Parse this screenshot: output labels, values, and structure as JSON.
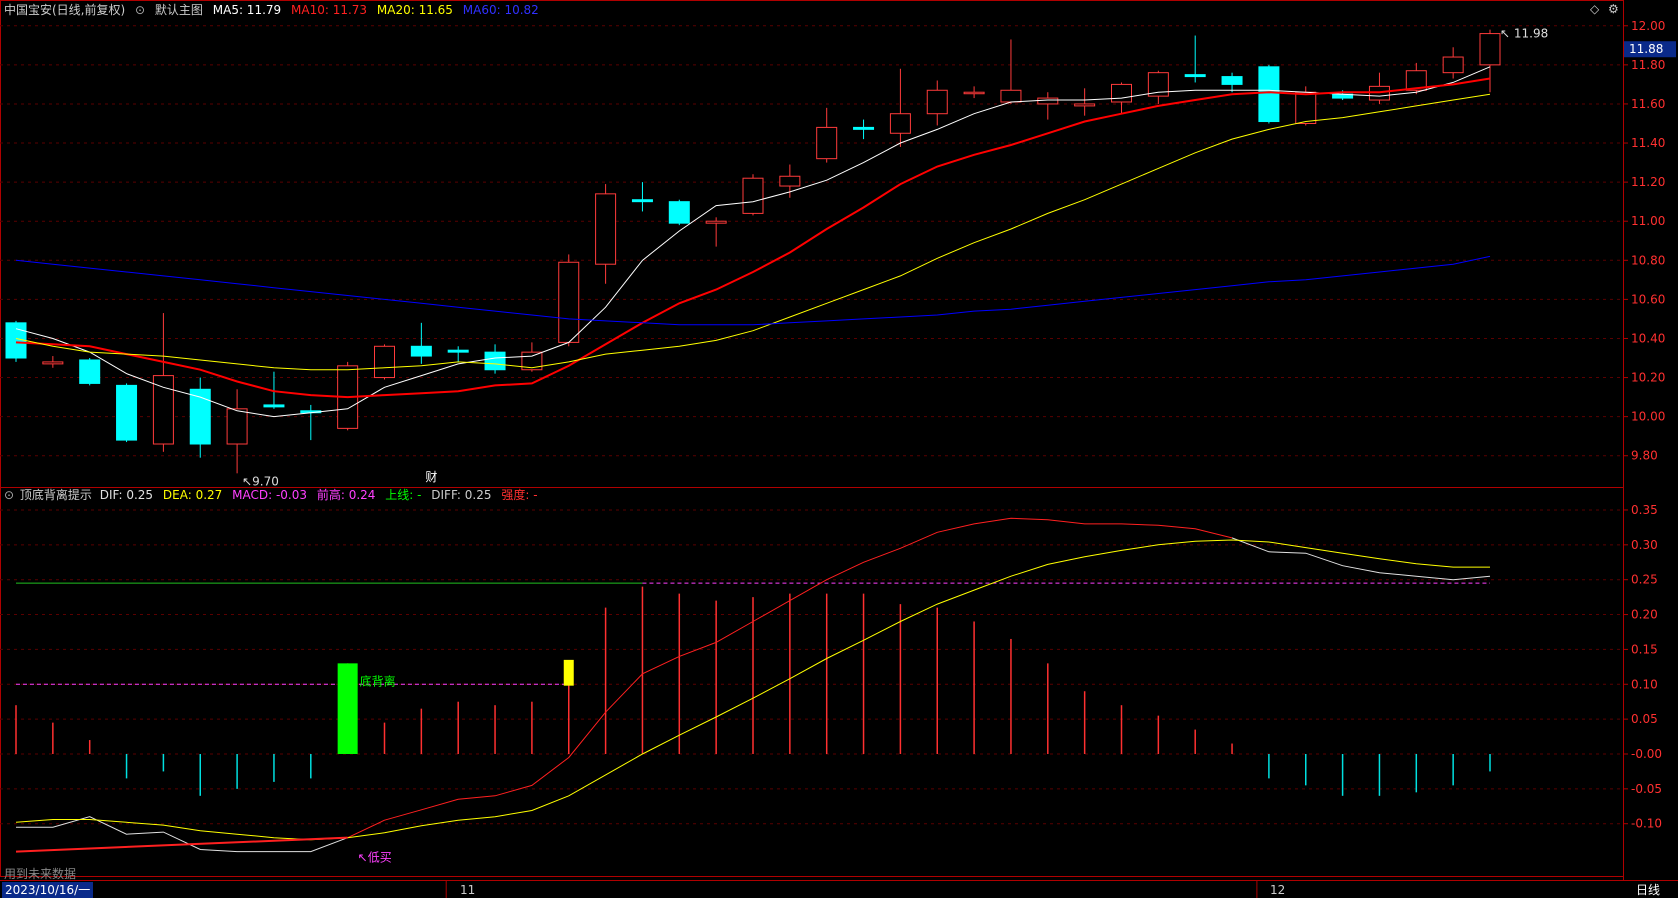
{
  "main_header": {
    "stock": "中国宝安(日线,前复权)",
    "template": "默认主图",
    "ma5": "MA5: 11.79",
    "ma10": "MA10: 11.73",
    "ma20": "MA20: 11.65",
    "ma60": "MA60: 10.82"
  },
  "sub_header": {
    "name": "顶底背离提示",
    "dif": "DIF: 0.25",
    "dea": "DEA: 0.27",
    "macd": "MACD: -0.03",
    "prev_high": "前高: 0.24",
    "upper_line": "上线: -",
    "diff": "DIFF: 0.25",
    "strength": "强度: -"
  },
  "colors": {
    "up": "#ff3b3b",
    "down": "#00ffff",
    "ma5": "#ffffff",
    "ma10": "#ff0000",
    "ma20": "#ffff00",
    "ma60": "#0000ff",
    "axis": "#b00000",
    "grid": "#5a0000",
    "dif": "#e0e0e0",
    "dea": "#ffff00"
  },
  "chart_data": [
    {
      "type": "candlestick",
      "title": "中国宝安(日线,前复权)",
      "ylim": [
        9.64,
        12.05
      ],
      "ticks": [
        "12.00",
        "11.80",
        "11.60",
        "11.40",
        "11.20",
        "11.00",
        "10.80",
        "10.60",
        "10.40",
        "10.20",
        "10.00",
        "9.80"
      ],
      "current_price": "11.88",
      "high_label": "11.98",
      "low_label": "9.70",
      "event_label": "财",
      "candles": [
        {
          "o": 10.48,
          "c": 10.3,
          "h": 10.49,
          "l": 10.28
        },
        {
          "o": 10.27,
          "c": 10.28,
          "h": 10.31,
          "l": 10.25
        },
        {
          "o": 10.29,
          "c": 10.17,
          "h": 10.3,
          "l": 10.16
        },
        {
          "o": 10.16,
          "c": 9.88,
          "h": 10.17,
          "l": 9.87
        },
        {
          "o": 9.86,
          "c": 10.21,
          "h": 10.53,
          "l": 9.82
        },
        {
          "o": 10.14,
          "c": 9.86,
          "h": 10.2,
          "l": 9.79
        },
        {
          "o": 9.86,
          "c": 10.04,
          "h": 10.14,
          "l": 9.71
        },
        {
          "o": 10.06,
          "c": 10.05,
          "h": 10.23,
          "l": 10.04
        },
        {
          "o": 10.03,
          "c": 10.02,
          "h": 10.06,
          "l": 9.88
        },
        {
          "o": 9.94,
          "c": 10.26,
          "h": 10.28,
          "l": 9.93
        },
        {
          "o": 10.2,
          "c": 10.36,
          "h": 10.37,
          "l": 10.19
        },
        {
          "o": 10.36,
          "c": 10.31,
          "h": 10.48,
          "l": 10.27
        },
        {
          "o": 10.34,
          "c": 10.33,
          "h": 10.36,
          "l": 10.28
        },
        {
          "o": 10.33,
          "c": 10.24,
          "h": 10.37,
          "l": 10.22
        },
        {
          "o": 10.24,
          "c": 10.33,
          "h": 10.38,
          "l": 10.23
        },
        {
          "o": 10.38,
          "c": 10.79,
          "h": 10.83,
          "l": 10.36
        },
        {
          "o": 10.78,
          "c": 11.14,
          "h": 11.19,
          "l": 10.68
        },
        {
          "o": 11.11,
          "c": 11.1,
          "h": 11.2,
          "l": 11.05
        },
        {
          "o": 11.1,
          "c": 10.99,
          "h": 11.11,
          "l": 10.98
        },
        {
          "o": 10.99,
          "c": 11.0,
          "h": 11.02,
          "l": 10.87
        },
        {
          "o": 11.04,
          "c": 11.22,
          "h": 11.24,
          "l": 11.03
        },
        {
          "o": 11.18,
          "c": 11.23,
          "h": 11.29,
          "l": 11.12
        },
        {
          "o": 11.32,
          "c": 11.48,
          "h": 11.58,
          "l": 11.3
        },
        {
          "o": 11.48,
          "c": 11.47,
          "h": 11.52,
          "l": 11.42
        },
        {
          "o": 11.45,
          "c": 11.55,
          "h": 11.78,
          "l": 11.38
        },
        {
          "o": 11.55,
          "c": 11.67,
          "h": 11.72,
          "l": 11.49
        },
        {
          "o": 11.66,
          "c": 11.66,
          "h": 11.69,
          "l": 11.63
        },
        {
          "o": 11.61,
          "c": 11.67,
          "h": 11.93,
          "l": 11.6
        },
        {
          "o": 11.6,
          "c": 11.63,
          "h": 11.66,
          "l": 11.52
        },
        {
          "o": 11.59,
          "c": 11.6,
          "h": 11.68,
          "l": 11.54
        },
        {
          "o": 11.61,
          "c": 11.7,
          "h": 11.71,
          "l": 11.55
        },
        {
          "o": 11.64,
          "c": 11.76,
          "h": 11.77,
          "l": 11.6
        },
        {
          "o": 11.75,
          "c": 11.74,
          "h": 11.95,
          "l": 11.71
        },
        {
          "o": 11.74,
          "c": 11.7,
          "h": 11.76,
          "l": 11.66
        },
        {
          "o": 11.79,
          "c": 11.51,
          "h": 11.8,
          "l": 11.5
        },
        {
          "o": 11.5,
          "c": 11.66,
          "h": 11.69,
          "l": 11.49
        },
        {
          "o": 11.65,
          "c": 11.63,
          "h": 11.67,
          "l": 11.62
        },
        {
          "o": 11.62,
          "c": 11.69,
          "h": 11.76,
          "l": 11.6
        },
        {
          "o": 11.67,
          "c": 11.77,
          "h": 11.81,
          "l": 11.65
        },
        {
          "o": 11.76,
          "c": 11.84,
          "h": 11.89,
          "l": 11.73
        },
        {
          "o": 11.8,
          "c": 11.96,
          "h": 11.98,
          "l": 11.66
        }
      ],
      "series": [
        {
          "name": "MA5",
          "color": "#ffffff",
          "values": [
            10.45,
            10.4,
            10.33,
            10.22,
            10.15,
            10.1,
            10.03,
            10.0,
            10.02,
            10.04,
            10.15,
            10.21,
            10.27,
            10.3,
            10.31,
            10.38,
            10.56,
            10.8,
            10.95,
            11.08,
            11.1,
            11.15,
            11.21,
            11.3,
            11.4,
            11.47,
            11.55,
            11.61,
            11.62,
            11.62,
            11.63,
            11.66,
            11.67,
            11.67,
            11.67,
            11.66,
            11.65,
            11.64,
            11.66,
            11.71,
            11.79
          ]
        },
        {
          "name": "MA10",
          "color": "#ff0000",
          "values": [
            10.38,
            10.37,
            10.36,
            10.32,
            10.28,
            10.24,
            10.18,
            10.13,
            10.11,
            10.1,
            10.11,
            10.12,
            10.13,
            10.16,
            10.17,
            10.26,
            10.37,
            10.48,
            10.58,
            10.65,
            10.74,
            10.84,
            10.96,
            11.07,
            11.19,
            11.28,
            11.34,
            11.39,
            11.45,
            11.51,
            11.55,
            11.59,
            11.62,
            11.65,
            11.66,
            11.65,
            11.66,
            11.66,
            11.68,
            11.7,
            11.73
          ]
        },
        {
          "name": "MA20",
          "color": "#ffff00",
          "values": [
            10.4,
            10.36,
            10.33,
            10.32,
            10.31,
            10.29,
            10.27,
            10.25,
            10.24,
            10.24,
            10.25,
            10.26,
            10.28,
            10.27,
            10.25,
            10.28,
            10.32,
            10.34,
            10.36,
            10.39,
            10.44,
            10.51,
            10.58,
            10.65,
            10.72,
            10.81,
            10.89,
            10.96,
            11.04,
            11.11,
            11.19,
            11.27,
            11.35,
            11.42,
            11.47,
            11.51,
            11.53,
            11.56,
            11.59,
            11.62,
            11.65
          ]
        },
        {
          "name": "MA60",
          "color": "#0000ff",
          "values": [
            10.8,
            10.78,
            10.76,
            10.74,
            10.72,
            10.7,
            10.68,
            10.66,
            10.64,
            10.62,
            10.6,
            10.58,
            10.56,
            10.54,
            10.52,
            10.5,
            10.49,
            10.48,
            10.47,
            10.47,
            10.47,
            10.48,
            10.49,
            10.5,
            10.51,
            10.52,
            10.54,
            10.55,
            10.57,
            10.59,
            10.61,
            10.63,
            10.65,
            10.67,
            10.69,
            10.7,
            10.72,
            10.74,
            10.76,
            10.78,
            10.82
          ]
        }
      ]
    },
    {
      "type": "macd",
      "title": "顶底背离提示",
      "ylim": [
        -0.175,
        0.36
      ],
      "ticks": [
        "0.35",
        "0.30",
        "0.25",
        "0.20",
        "0.15",
        "0.10",
        "0.05",
        "-0.00",
        "-0.05",
        "-0.10"
      ],
      "macd": [
        0.07,
        0.045,
        0.02,
        -0.035,
        -0.025,
        -0.06,
        -0.05,
        -0.04,
        -0.035,
        0.13,
        0.045,
        0.065,
        0.075,
        0.07,
        0.075,
        0.1,
        0.21,
        0.24,
        0.23,
        0.22,
        0.225,
        0.23,
        0.23,
        0.23,
        0.215,
        0.21,
        0.19,
        0.165,
        0.13,
        0.09,
        0.07,
        0.055,
        0.035,
        0.015,
        -0.035,
        -0.045,
        -0.06,
        -0.06,
        -0.055,
        -0.045,
        -0.025
      ],
      "dif": [
        -0.105,
        -0.105,
        -0.09,
        -0.115,
        -0.112,
        -0.137,
        -0.14,
        -0.14,
        -0.14,
        -0.12,
        -0.095,
        -0.08,
        -0.065,
        -0.06,
        -0.045,
        -0.005,
        0.06,
        0.115,
        0.14,
        0.16,
        0.19,
        0.22,
        0.25,
        0.275,
        0.295,
        0.318,
        0.33,
        0.338,
        0.336,
        0.33,
        0.33,
        0.328,
        0.323,
        0.31,
        0.29,
        0.288,
        0.27,
        0.26,
        0.255,
        0.25,
        0.255
      ],
      "dea": [
        -0.098,
        -0.094,
        -0.094,
        -0.098,
        -0.102,
        -0.11,
        -0.115,
        -0.12,
        -0.123,
        -0.12,
        -0.113,
        -0.103,
        -0.095,
        -0.09,
        -0.081,
        -0.06,
        -0.03,
        0.0,
        0.027,
        0.053,
        0.08,
        0.108,
        0.137,
        0.163,
        0.19,
        0.215,
        0.235,
        0.255,
        0.272,
        0.283,
        0.292,
        0.3,
        0.305,
        0.307,
        0.304,
        0.296,
        0.288,
        0.28,
        0.273,
        0.268,
        0.268
      ],
      "upper_line": 0.245,
      "prev_high_line": 0.1,
      "low_buy_label": "↖低买",
      "divergence_label": "底背离",
      "divergence_bar": 0.13,
      "warn_bar": [
        0.098,
        0.135
      ]
    }
  ],
  "footer": {
    "future_data": "用到未来数据",
    "date": "2023/10/16/一",
    "month_11": "11",
    "month_12": "12",
    "period_tab": "日线"
  }
}
